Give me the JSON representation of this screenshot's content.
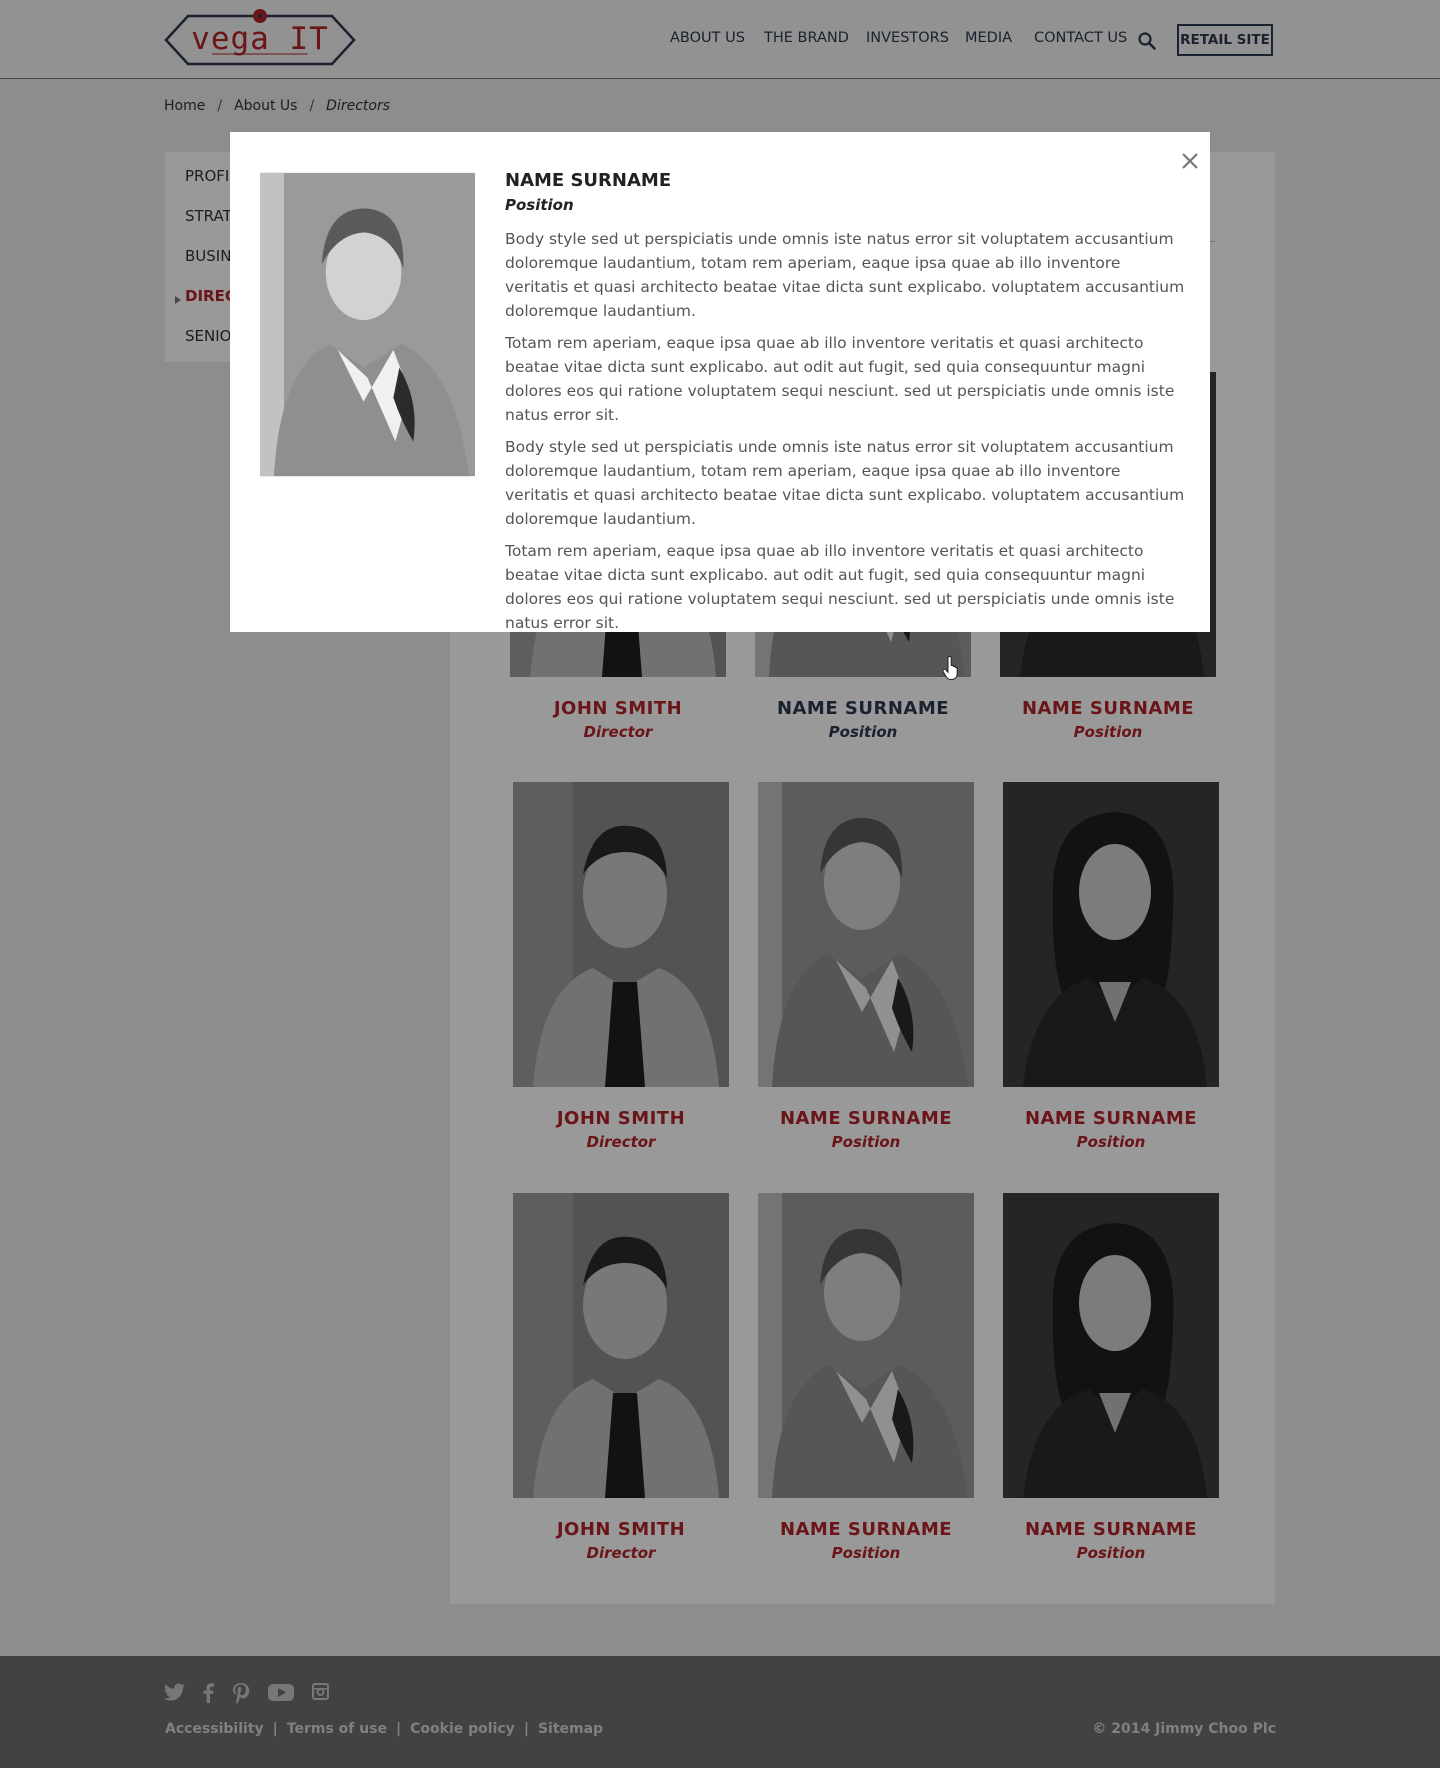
{
  "header": {
    "logo_text": "vega IT",
    "nav": [
      {
        "label": "ABOUT US"
      },
      {
        "label": "THE BRAND"
      },
      {
        "label": "INVESTORS"
      },
      {
        "label": "MEDIA"
      },
      {
        "label": "CONTACT US"
      }
    ],
    "search_icon": "search-icon",
    "retail_button": "RETAIL SITE"
  },
  "breadcrumb": {
    "items": [
      "Home",
      "About Us",
      "Directors"
    ],
    "separator": "/"
  },
  "sidebar": {
    "items": [
      {
        "label": "PROFI",
        "active": false
      },
      {
        "label": "STRAT",
        "active": false
      },
      {
        "label": "BUSIN",
        "active": false
      },
      {
        "label": "DIRECT",
        "active": true
      },
      {
        "label": "SENIO",
        "active": false
      }
    ]
  },
  "directors": [
    {
      "name": "JOHN SMITH",
      "position": "Director",
      "photo": "man"
    },
    {
      "name": "NAME SURNAME",
      "position": "Position",
      "photo": "woman-short-hair"
    },
    {
      "name": "NAME SURNAME",
      "position": "Position",
      "photo": "woman-long-hair"
    },
    {
      "name": "JOHN SMITH",
      "position": "Director",
      "photo": "man"
    },
    {
      "name": "NAME SURNAME",
      "position": "Position",
      "photo": "woman-short-hair"
    },
    {
      "name": "NAME SURNAME",
      "position": "Position",
      "photo": "woman-long-hair"
    },
    {
      "name": "JOHN SMITH",
      "position": "Director",
      "photo": "man"
    },
    {
      "name": "NAME SURNAME",
      "position": "Position",
      "photo": "woman-short-hair"
    },
    {
      "name": "NAME SURNAME",
      "position": "Position",
      "photo": "woman-long-hair"
    }
  ],
  "modal": {
    "name": "NAME SURNAME",
    "position": "Position",
    "close_icon": "close-icon",
    "paragraphs": [
      "Body style sed ut perspiciatis unde omnis iste natus error sit voluptatem accusantium doloremque laudantium, totam rem aperiam, eaque ipsa quae ab illo inventore veritatis et quasi architecto beatae vitae dicta sunt explicabo. voluptatem accusantium doloremque laudantium.",
      "Totam rem aperiam, eaque ipsa quae ab illo inventore veritatis et quasi architecto beatae vitae dicta sunt explicabo. aut odit aut fugit, sed quia consequuntur magni dolores eos qui ratione voluptatem sequi nesciunt. sed ut perspiciatis unde omnis iste natus error sit.",
      "Body style sed ut perspiciatis unde omnis iste natus error sit voluptatem accusantium doloremque laudantium, totam rem aperiam, eaque ipsa quae ab illo inventore veritatis et quasi architecto beatae vitae dicta sunt explicabo. voluptatem accusantium doloremque laudantium.",
      "Totam rem aperiam, eaque ipsa quae ab illo inventore veritatis et quasi architecto beatae vitae dicta sunt explicabo. aut odit aut fugit, sed quia consequuntur magni dolores eos qui ratione voluptatem sequi nesciunt. sed ut perspiciatis unde omnis iste natus error sit."
    ]
  },
  "footer": {
    "social_icons": [
      "twitter-icon",
      "facebook-icon",
      "pinterest-icon",
      "youtube-icon",
      "instagram-icon"
    ],
    "links": [
      "Accessibility",
      "Terms of use",
      "Cookie policy",
      "Sitemap"
    ],
    "separator": "|",
    "copyright": "© 2014 Jimmy Choo Plc"
  },
  "colors": {
    "accent_red": "#b3232b",
    "navy": "#2c3a4f",
    "footer_bg": "#6e6e6e",
    "overlay": "rgba(0,0,0,0.40)"
  }
}
